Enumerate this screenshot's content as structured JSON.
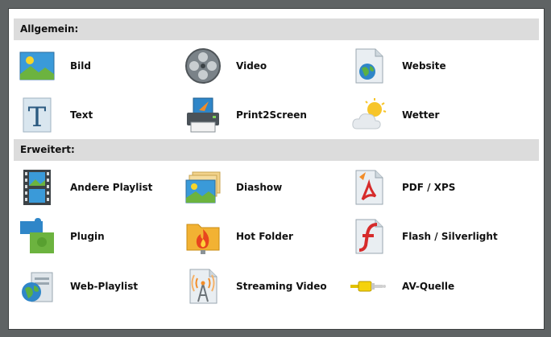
{
  "sections": {
    "general": {
      "title": "Allgemein:",
      "items": [
        {
          "label": "Bild",
          "icon": "image-icon"
        },
        {
          "label": "Video",
          "icon": "film-reel-icon"
        },
        {
          "label": "Website",
          "icon": "web-document-icon"
        },
        {
          "label": "Text",
          "icon": "text-document-icon"
        },
        {
          "label": "Print2Screen",
          "icon": "printer-icon"
        },
        {
          "label": "Wetter",
          "icon": "weather-icon"
        }
      ]
    },
    "advanced": {
      "title": "Erweitert:",
      "items": [
        {
          "label": "Andere Playlist",
          "icon": "film-strip-icon"
        },
        {
          "label": "Diashow",
          "icon": "slideshow-icon"
        },
        {
          "label": "PDF / XPS",
          "icon": "pdf-document-icon"
        },
        {
          "label": "Plugin",
          "icon": "puzzle-icon"
        },
        {
          "label": "Hot Folder",
          "icon": "hot-folder-icon"
        },
        {
          "label": "Flash / Silverlight",
          "icon": "flash-icon"
        },
        {
          "label": "Web-Playlist",
          "icon": "web-playlist-icon"
        },
        {
          "label": "Streaming Video",
          "icon": "streaming-antenna-icon"
        },
        {
          "label": "AV-Quelle",
          "icon": "av-cable-icon"
        }
      ]
    }
  },
  "colors": {
    "background": "#5f6364",
    "panel": "#ffffff",
    "section_header": "#dcdcdc"
  }
}
